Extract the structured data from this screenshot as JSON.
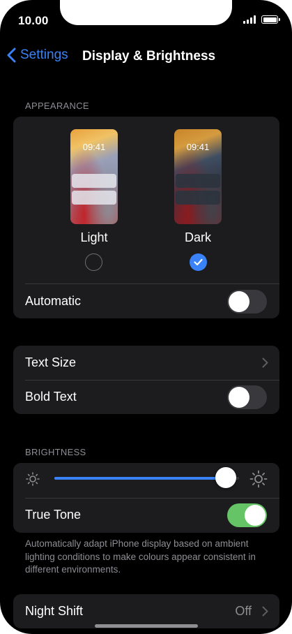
{
  "status_bar": {
    "time": "10.00"
  },
  "nav": {
    "back_label": "Settings",
    "title": "Display & Brightness"
  },
  "appearance": {
    "header": "APPEARANCE",
    "modes": [
      {
        "label": "Light",
        "preview_time": "09:41",
        "selected": false
      },
      {
        "label": "Dark",
        "preview_time": "09:41",
        "selected": true
      }
    ],
    "automatic": {
      "label": "Automatic",
      "on": false
    }
  },
  "text": {
    "text_size": {
      "label": "Text Size"
    },
    "bold_text": {
      "label": "Bold Text",
      "on": false
    }
  },
  "brightness": {
    "header": "BRIGHTNESS",
    "level": 0.93,
    "true_tone": {
      "label": "True Tone",
      "on": true
    },
    "footnote": "Automatically adapt iPhone display based on ambient lighting conditions to make colours appear consistent in different environments."
  },
  "night_shift": {
    "label": "Night Shift",
    "value": "Off"
  },
  "colors": {
    "accent": "#3a82f7",
    "toggle_on": "#65c466",
    "group_bg": "#1c1c1e",
    "secondary_text": "#8d8d93"
  },
  "icons": [
    "back-chevron-icon",
    "sun-small-icon",
    "sun-large-icon",
    "chevron-right-icon",
    "checkmark-icon",
    "cellular-signal-icon",
    "battery-icon"
  ]
}
